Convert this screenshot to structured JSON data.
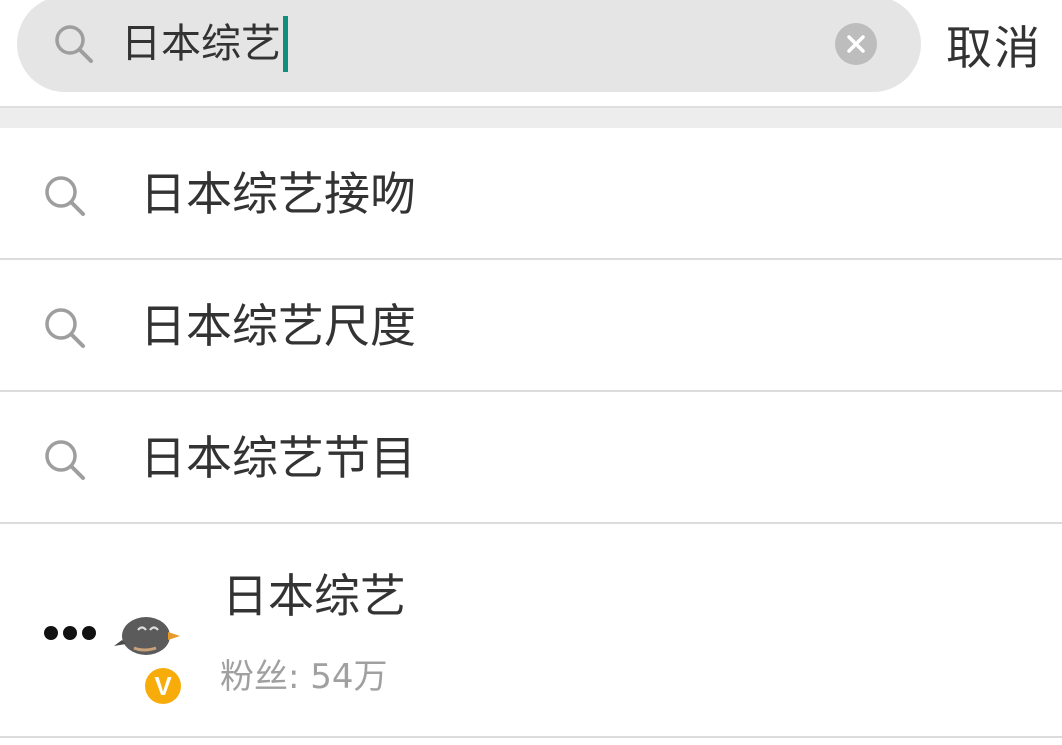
{
  "search": {
    "query": "日本综艺",
    "cancel_label": "取消",
    "icon": "search-icon",
    "clear_icon": "clear-icon"
  },
  "suggestions": [
    {
      "label": "日本综艺接吻",
      "icon": "search-icon"
    },
    {
      "label": "日本综艺尺度",
      "icon": "search-icon"
    },
    {
      "label": "日本综艺节目",
      "icon": "search-icon"
    }
  ],
  "user_result": {
    "name": "日本综艺",
    "fans": "粉丝: 54万",
    "verified_badge": "V",
    "icons": [
      "more-dots-icon",
      "avatar",
      "verified-badge-icon"
    ]
  },
  "colors": {
    "search_bg": "#e5e5e5",
    "caret": "#0e8f7e",
    "badge": "#f7ac0a",
    "divider": "#dcdcdc",
    "secondary_text": "#a0a0a0"
  }
}
